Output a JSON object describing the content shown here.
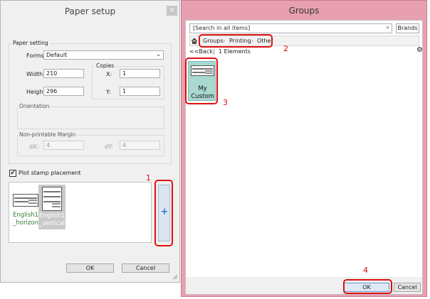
{
  "paper_setup": {
    "title": "Paper setup",
    "close_glyph": "×",
    "paper_setting_label": "Paper setting",
    "forms_label": "Forms",
    "forms_value": "Default",
    "copies_label": "Copies",
    "width_label": "Width",
    "width_value": "210",
    "height_label": "Height",
    "height_value": "296",
    "x_label": "X:",
    "x_value": "1",
    "y_label": "Y:",
    "y_value": "1",
    "orientation_label": "Orientation",
    "margin_label": "Non-printable Margin",
    "dx_label": "dX:",
    "dx_value": "4",
    "dy_label": "dY:",
    "dy_value": "4",
    "plot_stamp_label": "Plot stamp placement",
    "plot_stamp_checked": true,
    "stamps": [
      {
        "label": "English1\n_horizon",
        "selected": false
      },
      {
        "label": "English1\n_vertical",
        "selected": true
      }
    ],
    "add_glyph": "+",
    "ok_label": "OK",
    "cancel_label": "Cancel"
  },
  "groups": {
    "title": "Groups",
    "search_placeholder": "[Search in all items]",
    "brands_label": "Brands",
    "breadcrumb": [
      "Groups",
      "Printing",
      "Other"
    ],
    "back_label": "<<Back",
    "separator": "|",
    "count_label": "1 Elements",
    "item_label": "My\nCustom",
    "ok_label": "OK",
    "cancel_label": "Cancel"
  },
  "annotations": [
    "1",
    "2",
    "3",
    "4"
  ],
  "colors": {
    "groups_frame": "#e8a0b0",
    "annotation_red": "#e01010",
    "selected_item": "#a8d8d0",
    "add_blue": "#2a7ad0"
  }
}
